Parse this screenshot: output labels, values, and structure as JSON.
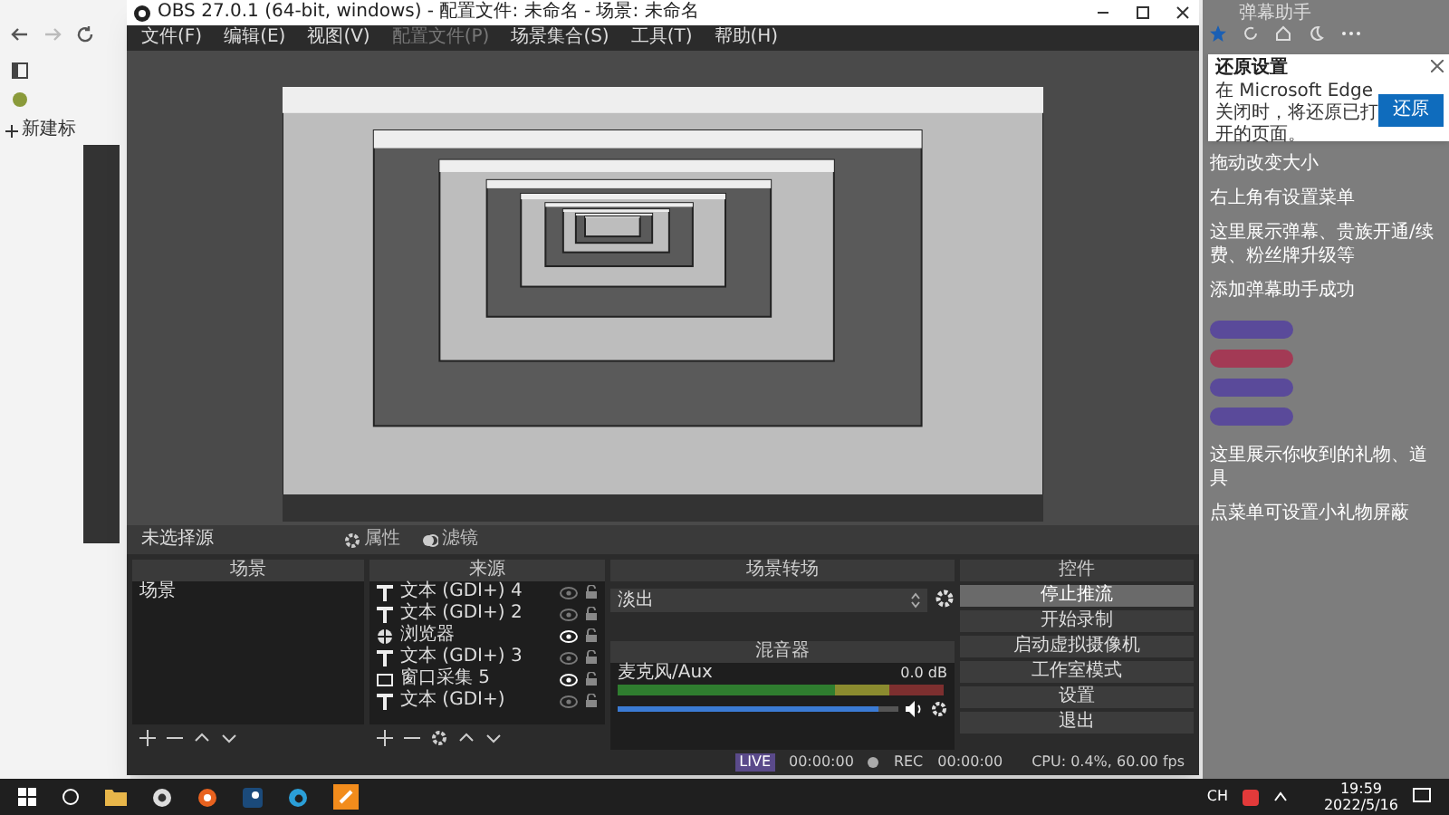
{
  "browser": {
    "new_tab": "新建标"
  },
  "obs": {
    "title": "OBS 27.0.1 (64-bit, windows) - 配置文件: 未命名 - 场景: 未命名",
    "menu": [
      {
        "label": "文件(F)",
        "disabled": false
      },
      {
        "label": "编辑(E)",
        "disabled": false
      },
      {
        "label": "视图(V)",
        "disabled": false
      },
      {
        "label": "配置文件(P)",
        "disabled": true
      },
      {
        "label": "场景集合(S)",
        "disabled": false
      },
      {
        "label": "工具(T)",
        "disabled": false
      },
      {
        "label": "帮助(H)",
        "disabled": false
      }
    ],
    "source_toolbar": {
      "label": "未选择源",
      "buttons": [
        {
          "kind": "properties",
          "label": "属性"
        },
        {
          "kind": "filters",
          "label": "滤镜"
        }
      ]
    },
    "scenes": {
      "title": "场景",
      "items": [
        {
          "label": "场景",
          "selected": false
        }
      ]
    },
    "sources": {
      "title": "来源",
      "items": [
        {
          "kind": "text",
          "label": "文本 (GDI+) 4",
          "visible": false
        },
        {
          "kind": "text",
          "label": "文本 (GDI+) 2",
          "visible": false
        },
        {
          "kind": "browser",
          "label": "浏览器",
          "visible": true
        },
        {
          "kind": "text",
          "label": "文本 (GDI+) 3",
          "visible": false
        },
        {
          "kind": "window",
          "label": "窗口采集 5",
          "visible": true
        },
        {
          "kind": "text",
          "label": "文本 (GDI+)",
          "visible": false
        }
      ]
    },
    "transitions": {
      "title": "场景转场",
      "value": "淡出"
    },
    "mixer": {
      "title": "混音器",
      "channels": [
        {
          "name": "麦克风/Aux",
          "reading": "0.0 dB",
          "level": 0.93
        }
      ]
    },
    "controls": {
      "title": "控件",
      "buttons": [
        {
          "label": "停止推流",
          "selected": true
        },
        {
          "label": "开始录制",
          "selected": false
        },
        {
          "label": "启动虚拟摄像机",
          "selected": false
        },
        {
          "label": "工作室模式",
          "selected": false
        },
        {
          "label": "设置",
          "selected": false
        },
        {
          "label": "退出",
          "selected": false
        }
      ]
    },
    "status": {
      "live": "LIVE",
      "live_time": "00:00:00",
      "rec": "REC",
      "rec_time": "00:00:00",
      "cpu": "CPU: 0.4%, 60.00 fps"
    }
  },
  "danmaku": {
    "title": "弹幕助手",
    "popup": {
      "title": "还原设置",
      "text": "在 Microsoft Edge 关闭时，将还原已打开的页面。",
      "button": "还原"
    },
    "lines": [
      "拖动改变大小",
      "右上角有设置菜单",
      "这里展示弹幕、贵族开通/续费、粉丝牌升级等",
      "添加弹幕助手成功",
      "这里展示你收到的礼物、道具",
      "点菜单可设置小礼物屏蔽"
    ]
  },
  "taskbar": {
    "lang": "CH",
    "time": "19:59",
    "date": "2022/5/16"
  }
}
